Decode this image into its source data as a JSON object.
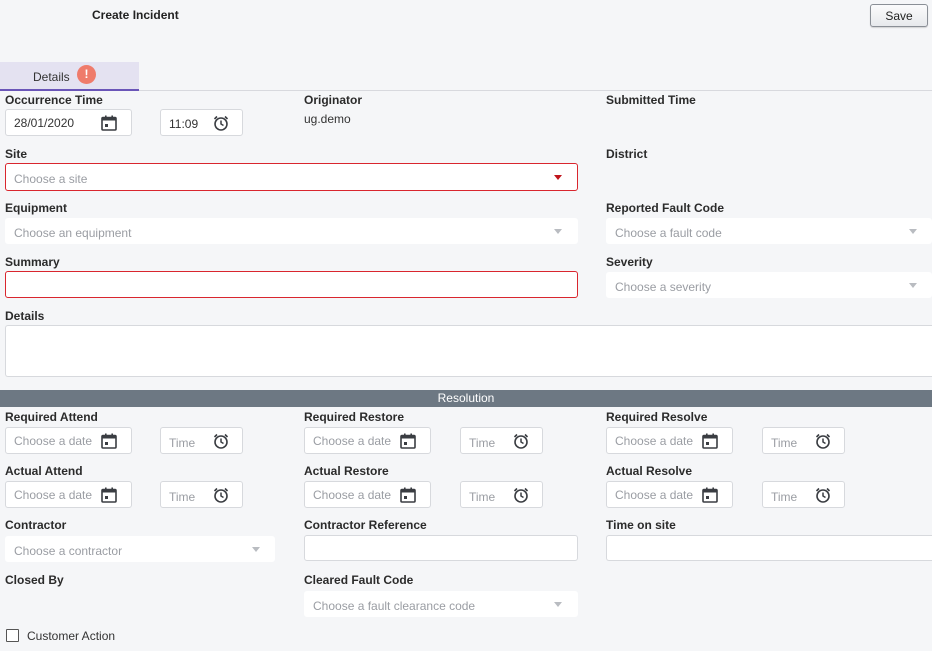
{
  "header": {
    "title": "Create Incident",
    "save_label": "Save"
  },
  "tabs": [
    {
      "label": "Details",
      "badge": "!"
    }
  ],
  "details": {
    "occurrence_time_label": "Occurrence Time",
    "occurrence_date": "28/01/2020",
    "occurrence_time": "11:09",
    "originator_label": "Originator",
    "originator_value": "ug.demo",
    "submitted_time_label": "Submitted Time",
    "site_label": "Site",
    "site_placeholder": "Choose a site",
    "district_label": "District",
    "equipment_label": "Equipment",
    "equipment_placeholder": "Choose an equipment",
    "reported_fault_code_label": "Reported Fault Code",
    "fault_code_placeholder": "Choose a fault code",
    "summary_label": "Summary",
    "severity_label": "Severity",
    "severity_placeholder": "Choose a severity",
    "details_label": "Details"
  },
  "resolution": {
    "banner": "Resolution",
    "required_attend_label": "Required Attend",
    "required_restore_label": "Required Restore",
    "required_resolve_label": "Required Resolve",
    "actual_attend_label": "Actual Attend",
    "actual_restore_label": "Actual Restore",
    "actual_resolve_label": "Actual Resolve",
    "date_placeholder": "Choose a date",
    "time_placeholder": "Time",
    "contractor_label": "Contractor",
    "contractor_placeholder": "Choose a contractor",
    "contractor_reference_label": "Contractor Reference",
    "time_on_site_label": "Time on site",
    "closed_by_label": "Closed By",
    "cleared_fault_code_label": "Cleared Fault Code",
    "cleared_fault_code_placeholder": "Choose a fault clearance code",
    "customer_action_label": "Customer Action"
  },
  "icons": {
    "calendar": "calendar-icon",
    "clock": "clock-icon",
    "dropdown": "chevron-down-icon",
    "alert": "alert-icon"
  },
  "colors": {
    "error_border": "#d9262e",
    "tab_accent": "#6a55b8",
    "banner_bg": "#6d7883",
    "badge_bg": "#ef7b6b"
  }
}
